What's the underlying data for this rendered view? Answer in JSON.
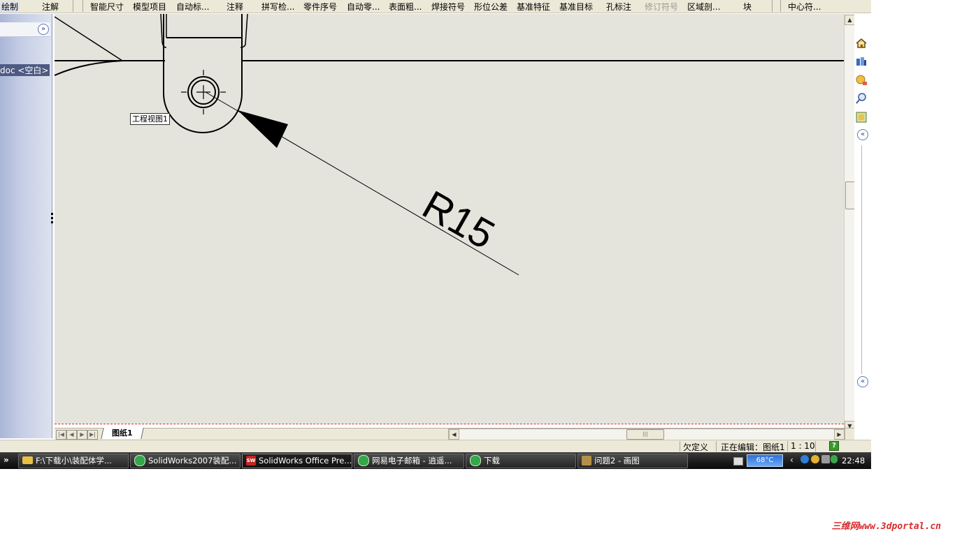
{
  "toolbar": {
    "items": [
      {
        "label": "绘制",
        "state": "active"
      },
      {
        "label": "注解",
        "state": "normal"
      },
      {
        "label": "智能尺寸",
        "state": "normal"
      },
      {
        "label": "模型项目",
        "state": "normal"
      },
      {
        "label": "自动标...",
        "state": "normal"
      },
      {
        "label": "注释",
        "state": "normal"
      },
      {
        "label": "拼写检...",
        "state": "normal"
      },
      {
        "label": "零件序号",
        "state": "normal"
      },
      {
        "label": "自动零...",
        "state": "normal"
      },
      {
        "label": "表面粗...",
        "state": "normal"
      },
      {
        "label": "焊接符号",
        "state": "normal"
      },
      {
        "label": "形位公差",
        "state": "normal"
      },
      {
        "label": "基准特征",
        "state": "normal"
      },
      {
        "label": "基准目标",
        "state": "normal"
      },
      {
        "label": "孔标注",
        "state": "normal"
      },
      {
        "label": "修订符号",
        "state": "disabled"
      },
      {
        "label": "区域剖...",
        "state": "normal"
      },
      {
        "label": "块",
        "state": "normal"
      },
      {
        "label": "中心符...",
        "state": "normal"
      }
    ]
  },
  "left_panel": {
    "expand_icon": "double-chevron-right-icon",
    "doc_label": "doc <空白>"
  },
  "drawing": {
    "view_label": "工程视图1",
    "dimension_text": "R15",
    "line_color": "#000000",
    "background": "#e5e4dc"
  },
  "right_pane": {
    "icons": [
      "home-icon",
      "view-palette-icon",
      "appearance-icon",
      "search-icon",
      "custom-properties-icon"
    ],
    "collapse_icon": "double-chevron-left-icon"
  },
  "sheet_tabs": {
    "active": "图纸1"
  },
  "status_bar": {
    "definition": "欠定义",
    "editing": "正在编辑：图纸1",
    "scale": "1 : 10",
    "help_icon": "help-icon"
  },
  "taskbar": {
    "tasks": [
      {
        "label": "F:\\下载小\\装配体学...",
        "icon": "folder",
        "active": false
      },
      {
        "label": "SolidWorks2007装配...",
        "icon": "ie",
        "active": false
      },
      {
        "label": "SolidWorks Office Pre...",
        "icon": "sw",
        "active": true
      },
      {
        "label": "网易电子邮箱 - 逍遥...",
        "icon": "ie",
        "active": false
      },
      {
        "label": "下载",
        "icon": "ie",
        "active": false
      },
      {
        "label": "问题2 - 画图",
        "icon": "paint",
        "active": false
      }
    ],
    "temperature": "68°C",
    "clock": "22:48"
  },
  "watermark": "三维网www.3dportal.cn"
}
